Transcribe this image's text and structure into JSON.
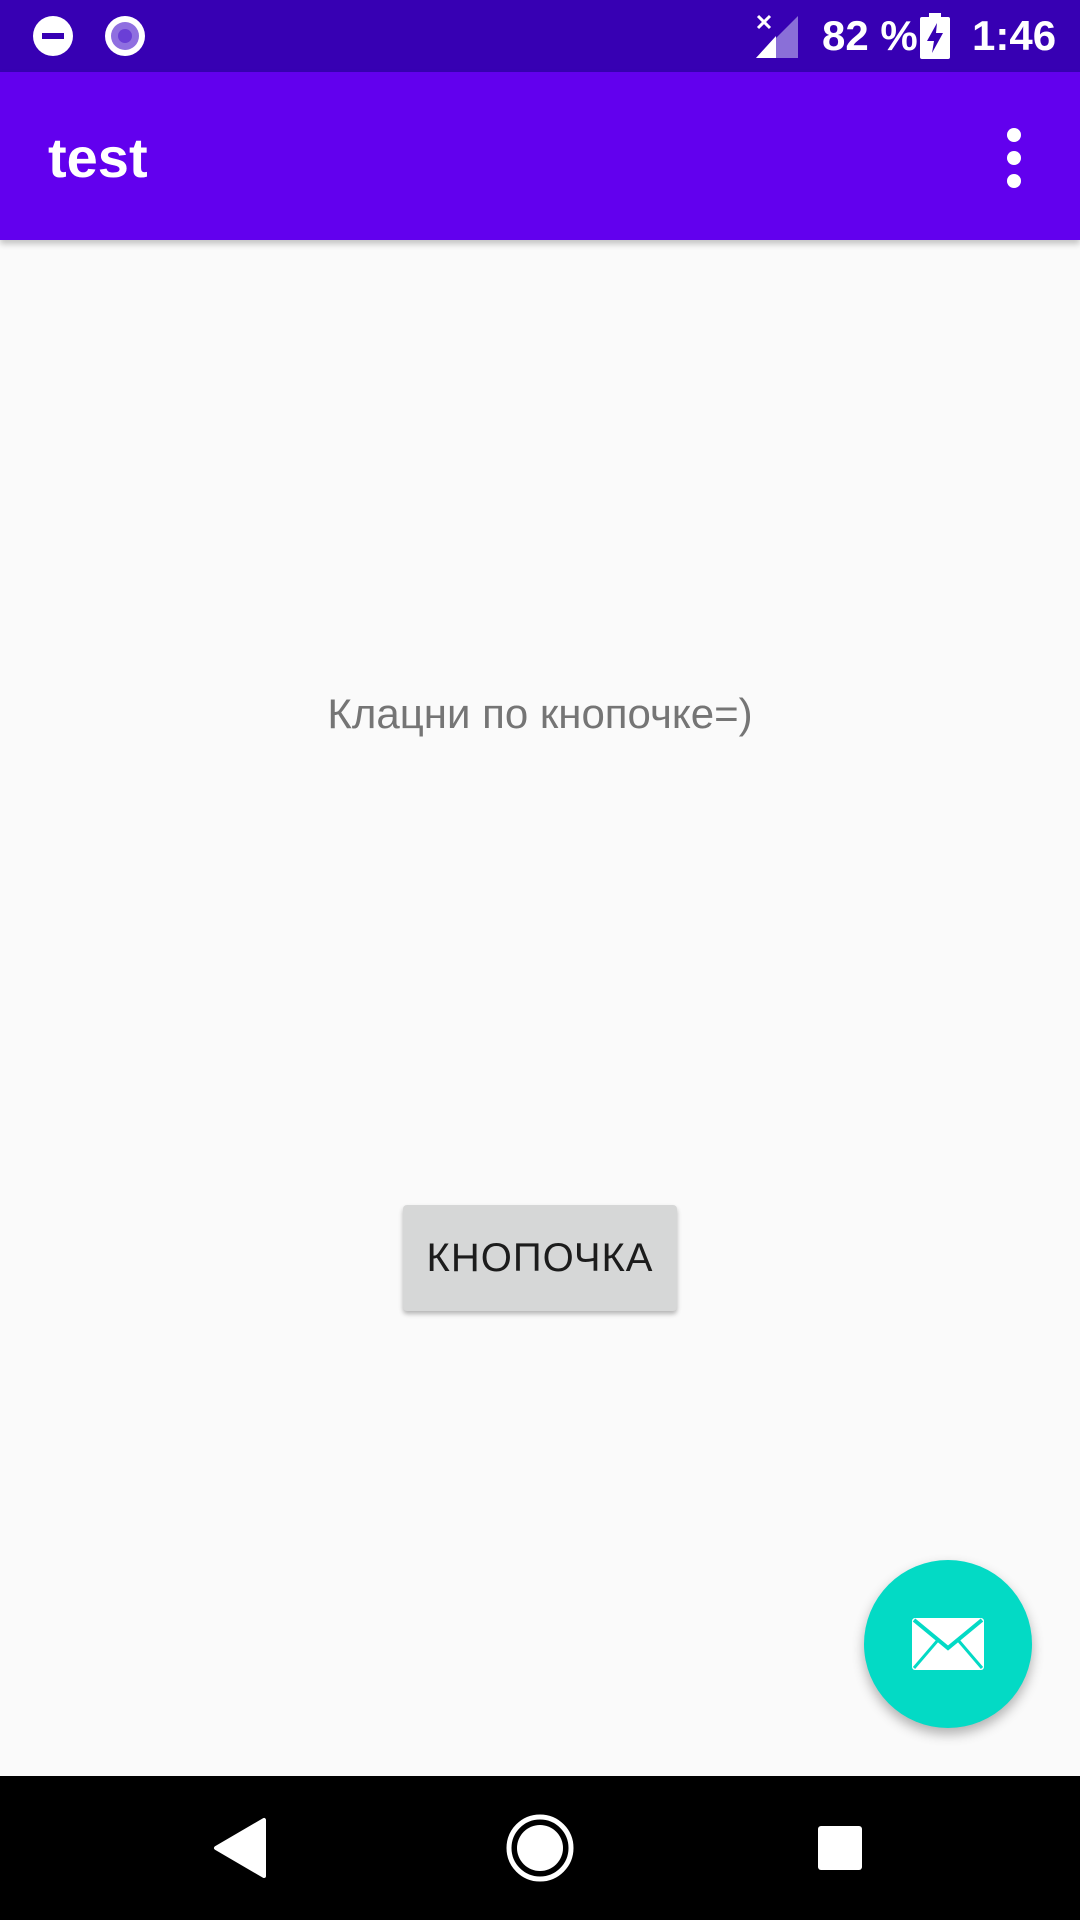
{
  "status_bar": {
    "left_icons": [
      "do-not-disturb-icon",
      "screen-record-icon"
    ],
    "signal_icon": "no-signal-icon",
    "battery_percent": "82 %",
    "battery_icon": "battery-charging-icon",
    "time": "1:46"
  },
  "app_bar": {
    "title": "test",
    "menu_icon": "more-vert-icon"
  },
  "content": {
    "hint": "Клацни по кнопочке=)",
    "button_label": "КНОПОЧКА"
  },
  "fab": {
    "icon": "email-icon"
  },
  "nav_bar": {
    "buttons": [
      "back-icon",
      "home-icon",
      "recents-icon"
    ]
  },
  "colors": {
    "status_bar": "#3700b3",
    "app_bar": "#6200ee",
    "fab": "#03dac5",
    "button": "#d6d7d7",
    "background": "#fafafa"
  }
}
